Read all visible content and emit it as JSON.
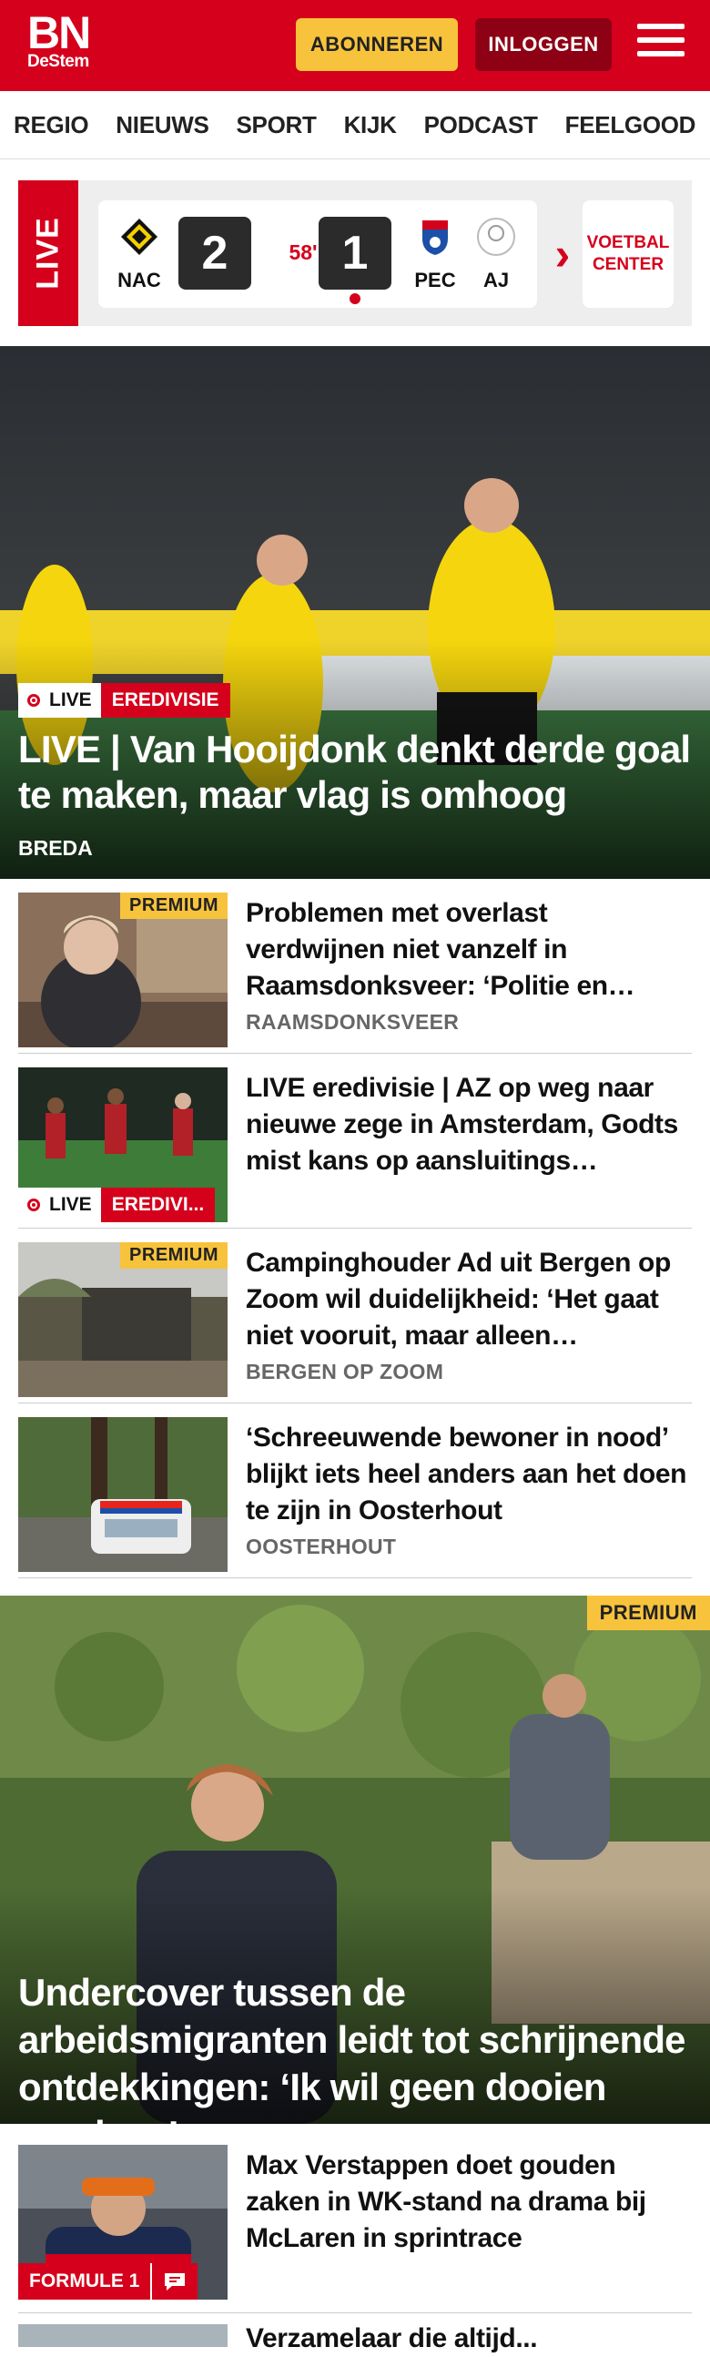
{
  "header": {
    "logo_big": "BN",
    "logo_small": "DeStem",
    "subscribe_label": "ABONNEREN",
    "login_label": "INLOGGEN",
    "brand_color": "#d5001c"
  },
  "nav": {
    "items": [
      "REGIO",
      "NIEUWS",
      "SPORT",
      "KIJK",
      "PODCAST",
      "FEELGOOD"
    ]
  },
  "live_scores": {
    "live_label": "LIVE",
    "match": {
      "home": "NAC",
      "away": "PEC",
      "home_score": "2",
      "away_score": "1",
      "minute": "58'"
    },
    "next_team": "AJ",
    "voetbal_center": "VOETBAL CENTER"
  },
  "hero": {
    "live_badge": "LIVE",
    "category": "EREDIVISIE",
    "title": "LIVE | Van Hooijdonk denkt derde goal te maken, maar vlag is omhoog",
    "location": "BREDA"
  },
  "articles": [
    {
      "title": "Problemen met overlast verdwijnen niet vanzelf in Raamsdonksveer: ‘Politie en…",
      "location": "RAAMSDONKSVEER",
      "premium": "PREMIUM"
    },
    {
      "title": "LIVE eredivisie | AZ op weg naar nieuwe zege in Amsterdam, Godts mist kans op aansluitings…",
      "live_badge": "LIVE",
      "category": "EREDIVI..."
    },
    {
      "title": "Campinghouder Ad uit Bergen op Zoom wil duidelijkheid: ‘Het gaat niet vooruit, maar alleen…",
      "location": "BERGEN OP ZOOM",
      "premium": "PREMIUM"
    },
    {
      "title": "‘Schreeuwende bewoner in nood’ blijkt iets heel anders aan het doen te zijn in Oosterhout",
      "location": "OOSTERHOUT"
    }
  ],
  "feature": {
    "premium": "PREMIUM",
    "title": "Undercover tussen de arbeidsmigranten leidt tot schrijnende ontdekkingen: ‘Ik wil geen dooien vandaag’"
  },
  "article_f1": {
    "title": "Max Verstappen doet gouden zaken in WK-stand na drama bij McLaren in sprintrace",
    "category": "FORMULE 1"
  },
  "article_last": {
    "title": "Verzamelaar die altijd..."
  }
}
